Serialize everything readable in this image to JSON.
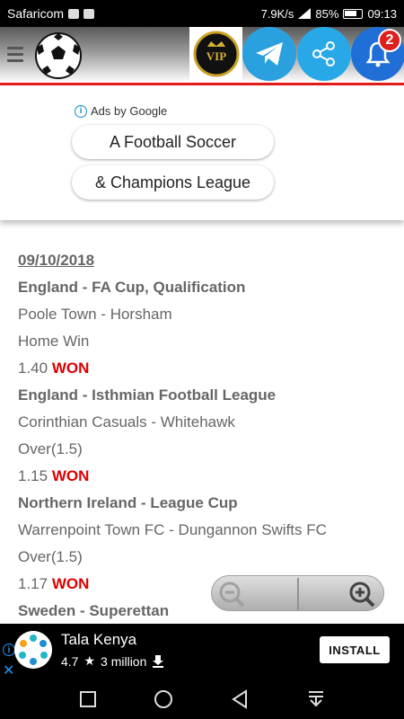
{
  "status_bar": {
    "carrier": "Safaricom",
    "speed": "7.9K/s",
    "battery": "85%",
    "time": "09:13"
  },
  "header": {
    "vip_label": "VIP",
    "notification_count": "2",
    "accent_color": "#e21b1b"
  },
  "ad_panel": {
    "ads_by": "Ads by Google",
    "pill_1": "A Football Soccer",
    "pill_2": "& Champions League"
  },
  "tips": {
    "date": "09/10/2018",
    "rows": [
      {
        "type": "league",
        "text": "England - FA Cup, Qualification"
      },
      {
        "type": "match",
        "text": "Poole Town - Horsham"
      },
      {
        "type": "pick",
        "text": "Home Win"
      },
      {
        "type": "odds",
        "odds": "1.40",
        "result": "WON"
      },
      {
        "type": "league",
        "text": "England - Isthmian Football League"
      },
      {
        "type": "match",
        "text": "Corinthian Casuals - Whitehawk"
      },
      {
        "type": "pick",
        "text": "Over(1.5)"
      },
      {
        "type": "odds",
        "odds": "1.15",
        "result": "WON"
      },
      {
        "type": "league",
        "text": "Northern Ireland - League Cup"
      },
      {
        "type": "match",
        "text": "Warrenpoint Town FC - Dungannon Swifts FC"
      },
      {
        "type": "pick",
        "text": "Over(1.5)"
      },
      {
        "type": "odds",
        "odds": "1.17",
        "result": "WON"
      },
      {
        "type": "league",
        "text": "Sweden - Superettan"
      }
    ]
  },
  "bottom_ad": {
    "app_name": "Tala Kenya",
    "rating": "4.7",
    "installs": "3 million",
    "install_label": "INSTALL"
  }
}
